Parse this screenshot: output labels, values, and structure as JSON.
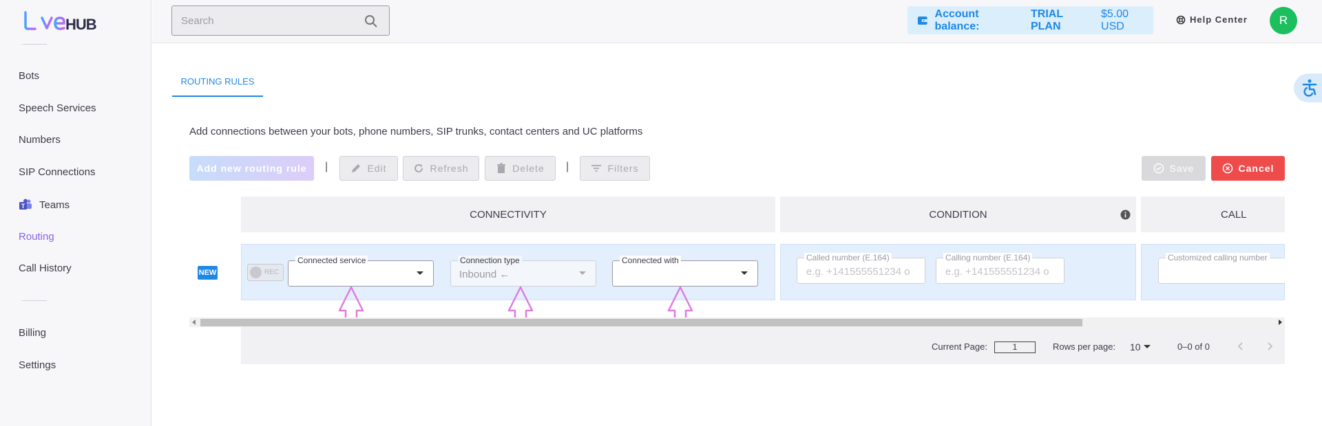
{
  "brand": {
    "logo_text": "LiveHUB"
  },
  "sidebar": {
    "items": [
      {
        "label": "Bots"
      },
      {
        "label": "Speech Services"
      },
      {
        "label": "Numbers"
      },
      {
        "label": "SIP Connections"
      },
      {
        "label": "Teams"
      },
      {
        "label": "Routing",
        "active": true
      },
      {
        "label": "Call History"
      },
      {
        "label": "Billing"
      },
      {
        "label": "Settings"
      }
    ]
  },
  "header": {
    "search_placeholder": "Search",
    "balance_label": "Account balance:",
    "plan": "TRIAL PLAN",
    "amount": "$5.00 USD",
    "help": "Help Center",
    "avatar_initial": "R"
  },
  "tabs": [
    {
      "label": "ROUTING RULES",
      "active": true
    }
  ],
  "description": "Add connections between your bots, phone numbers, SIP trunks, contact centers and UC platforms",
  "toolbar": {
    "add": "Add new routing rule",
    "edit": "Edit",
    "refresh": "Refresh",
    "delete": "Delete",
    "filters": "Filters",
    "save": "Save",
    "cancel": "Cancel",
    "separator": "|"
  },
  "grid": {
    "columns": {
      "connectivity": "CONNECTIVITY",
      "condition": "CONDITION",
      "call": "CALL"
    },
    "row": {
      "badge": "NEW",
      "rec": "REC",
      "connected_service_label": "Connected service",
      "connection_type_label": "Connection type",
      "connection_type_value": "Inbound",
      "connection_type_arrow": "←",
      "connected_with_label": "Connected with",
      "called_number_label": "Called number (E.164)",
      "called_number_placeholder": "e.g. +141555551234 o",
      "calling_number_label": "Calling number (E.164)",
      "calling_number_placeholder": "e.g. +141555551234 o",
      "custom_calling_label": "Customized calling number"
    }
  },
  "pagination": {
    "current_page_label": "Current Page:",
    "current_page": "1",
    "rows_per_page_label": "Rows per page:",
    "rows_per_page": "10",
    "range": "0–0 of 0"
  },
  "colors": {
    "accent": "#1e88e5",
    "active_nav": "#8a63e6",
    "cancel": "#ee4b4b",
    "avatar": "#1bbf5d",
    "annotation": "#e07be0"
  }
}
